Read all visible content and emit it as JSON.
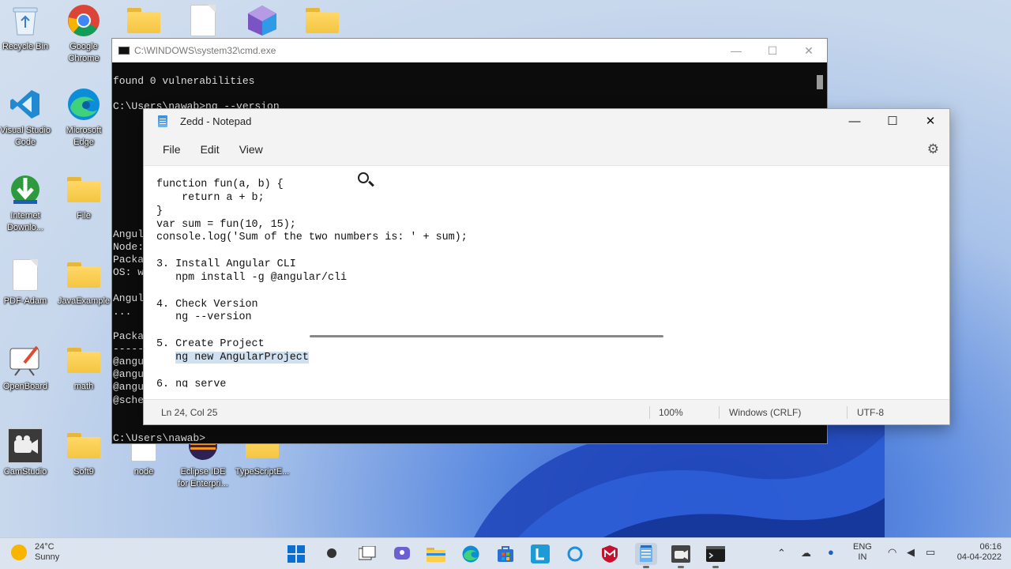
{
  "desktop": {
    "icons": [
      {
        "label": "Recycle Bin",
        "icon": "recycle-bin-icon"
      },
      {
        "label": "Google Chrome",
        "icon": "chrome-icon"
      },
      {
        "label": "Visual Studio Code",
        "icon": "vscode-icon"
      },
      {
        "label": "Microsoft Edge",
        "icon": "edge-icon"
      },
      {
        "label": "Internet Downlo...",
        "icon": "idm-icon"
      },
      {
        "label": "File",
        "icon": "folder-icon"
      },
      {
        "label": "PDF-Adam",
        "icon": "document-icon"
      },
      {
        "label": "JavaExample",
        "icon": "folder-icon"
      },
      {
        "label": "OpenBoard",
        "icon": "openboard-icon"
      },
      {
        "label": "math",
        "icon": "folder-icon"
      },
      {
        "label": "CamStudio",
        "icon": "camstudio-icon"
      },
      {
        "label": "Soft9",
        "icon": "folder-icon"
      },
      {
        "label": "node",
        "icon": "document-icon"
      },
      {
        "label": "Eclipse IDE for Enterpri...",
        "icon": "eclipse-icon"
      },
      {
        "label": "TypeScriptE...",
        "icon": "folder-icon"
      }
    ]
  },
  "cmd": {
    "title": "C:\\WINDOWS\\system32\\cmd.exe",
    "lines": {
      "l1": "found 0 vulnerabilities",
      "l2": "C:\\Users\\nawab>ng --version",
      "l3": "Angul",
      "l4": "Node:",
      "l5": "Packa",
      "l6": "OS: w",
      "l7": "Angul",
      "l8": "...",
      "l9": "Packa",
      "l10": "-----",
      "l11": "@angu",
      "l12": "@angu",
      "l13": "@angu",
      "l14": "@sche",
      "prompt": "C:\\Users\\nawab>"
    }
  },
  "notepad": {
    "title": "Zedd - Notepad",
    "menu": {
      "file": "File",
      "edit": "Edit",
      "view": "View"
    },
    "content": {
      "c1": "function fun(a, b) {",
      "c2": "    return a + b;",
      "c3": "}",
      "c4": "var sum = fun(10, 15);",
      "c5": "console.log('Sum of the two numbers is: ' + sum);",
      "c6": "",
      "c7": "3. Install Angular CLI",
      "c8": "   npm install -g @angular/cli",
      "c9": "",
      "c10": "4. Check Version",
      "c11": "   ng --version",
      "c12": "",
      "c13": "5. Create Project",
      "c14_indent": "   ",
      "c14_selected": "ng new AngularProject",
      "c15": "",
      "c16": "6. ng serve"
    },
    "status": {
      "position": "Ln 24, Col 25",
      "zoom": "100%",
      "line_ending": "Windows (CRLF)",
      "encoding": "UTF-8"
    }
  },
  "taskbar": {
    "weather": {
      "temp": "24°C",
      "condition": "Sunny"
    },
    "apps": [
      "start-icon",
      "search-icon",
      "task-view-icon",
      "chat-icon",
      "file-explorer-icon",
      "edge-icon",
      "store-icon",
      "launcher-icon",
      "cortana-icon",
      "mcafee-icon",
      "notepad-icon",
      "camstudio-icon",
      "terminal-icon"
    ],
    "tray": {
      "lang_top": "ENG",
      "lang_bottom": "IN",
      "time": "06:16",
      "date": "04-04-2022"
    }
  }
}
